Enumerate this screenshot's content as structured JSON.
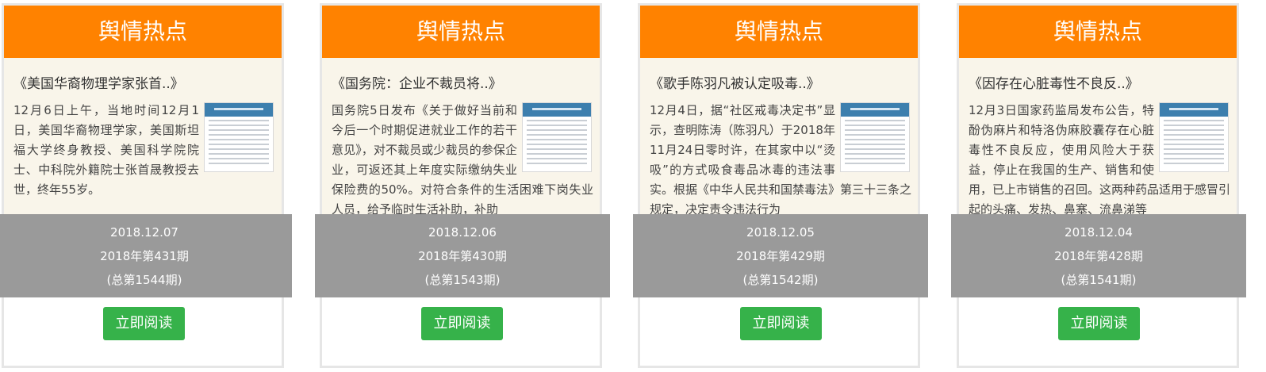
{
  "cards": [
    {
      "header": "舆情热点",
      "title": "《美国华裔物理学家张首..》",
      "summary": "12月6日上午，当地时间12月1日，美国华裔物理学家，美国斯坦福大学终身教授、美国科学院院士、中科院外籍院士张首晟教授去世，终年55岁。",
      "date": "2018.12.07",
      "issue": "2018年第431期",
      "total": "(总第1544期)",
      "button": "立即阅读"
    },
    {
      "header": "舆情热点",
      "title": "《国务院：企业不裁员将..》",
      "summary": "国务院5日发布《关于做好当前和今后一个时期促进就业工作的若干意见》，对不裁员或少裁员的参保企业，可返还其上年度实际缴纳失业保险费的50%。对符合条件的生活困难下岗失业人员，给予临时生活补助，补助",
      "date": "2018.12.06",
      "issue": "2018年第430期",
      "total": "(总第1543期)",
      "button": "立即阅读"
    },
    {
      "header": "舆情热点",
      "title": "《歌手陈羽凡被认定吸毒..》",
      "summary": "12月4日，据“社区戒毒决定书”显示，查明陈涛（陈羽凡）于2018年11月24日零时许，在其家中以“烫吸”的方式吸食毒品冰毒的违法事实。根据《中华人民共和国禁毒法》第三十三条之规定，决定责令违法行为",
      "date": "2018.12.05",
      "issue": "2018年第429期",
      "total": "(总第1542期)",
      "button": "立即阅读"
    },
    {
      "header": "舆情热点",
      "title": "《因存在心脏毒性不良反..》",
      "summary": "12月3日国家药监局发布公告，特酚伪麻片和特洛伪麻胶囊存在心脏毒性不良反应，使用风险大于获益，停止在我国的生产、销售和使用，已上市销售的召回。这两种药品适用于感冒引起的头痛、发热、鼻塞、流鼻涕等",
      "date": "2018.12.04",
      "issue": "2018年第428期",
      "total": "(总第1541期)",
      "button": "立即阅读"
    }
  ],
  "thumbnail_icon": "report-thumbnail-image",
  "colors": {
    "header": "#ff8200",
    "body": "#f9f5ea",
    "date_bar": "#9a9a9a",
    "button": "#36b24a"
  }
}
